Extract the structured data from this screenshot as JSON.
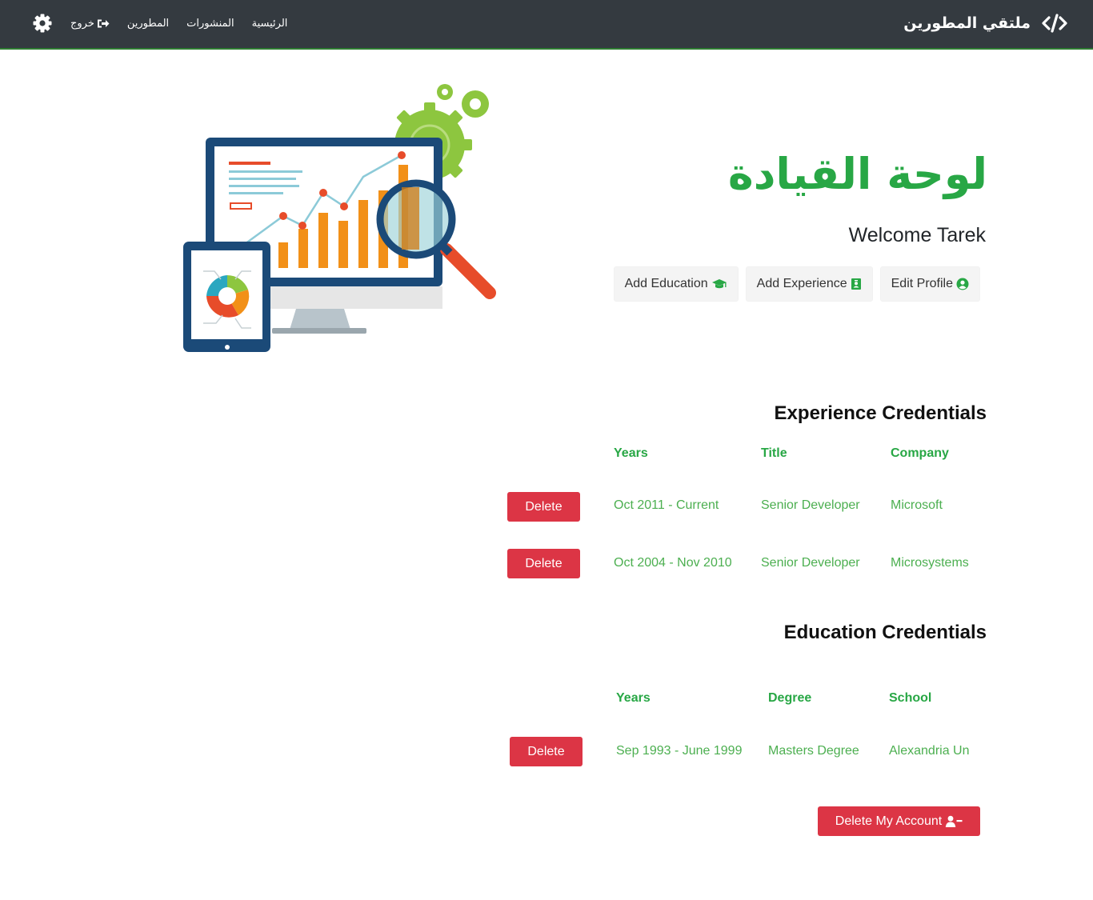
{
  "navbar": {
    "brand": "ملتقي المطورين",
    "links": {
      "home": "الرئيسية",
      "posts": "المنشورات",
      "developers": "المطورين",
      "logout": "خروج"
    }
  },
  "dashboard": {
    "title": "لوحة القيادة",
    "welcome": "Welcome Tarek",
    "buttons": {
      "add_education": "Add Education",
      "add_experience": "Add Experience",
      "edit_profile": "Edit Profile"
    }
  },
  "experience": {
    "heading": "Experience Credentials",
    "columns": {
      "years": "Years",
      "title": "Title",
      "company": "Company"
    },
    "rows": [
      {
        "years": "Oct 2011 - Current",
        "title": "Senior Developer",
        "company": "Microsoft",
        "delete": "Delete"
      },
      {
        "years": "Oct 2004 - Nov 2010",
        "title": "Senior Developer",
        "company": "Microsystems",
        "delete": "Delete"
      }
    ]
  },
  "education": {
    "heading": "Education Credentials",
    "columns": {
      "years": "Years",
      "degree": "Degree",
      "school": "School"
    },
    "rows": [
      {
        "years": "Sep 1993 - June 1999",
        "degree": "Masters Degree",
        "school": "Alexandria Un",
        "delete": "Delete"
      }
    ]
  },
  "account": {
    "delete_label": "Delete My Account"
  },
  "colors": {
    "navbar": "#343a40",
    "accent_green": "#28a745",
    "danger": "#dc3545",
    "light_button": "#f4f4f4"
  },
  "icons": {
    "brand": "code-icon",
    "settings": "gear-icon",
    "logout": "sign-out-icon",
    "education": "graduation-cap-icon",
    "experience": "id-badge-icon",
    "profile": "user-circle-icon",
    "delete_account": "user-minus-icon"
  }
}
